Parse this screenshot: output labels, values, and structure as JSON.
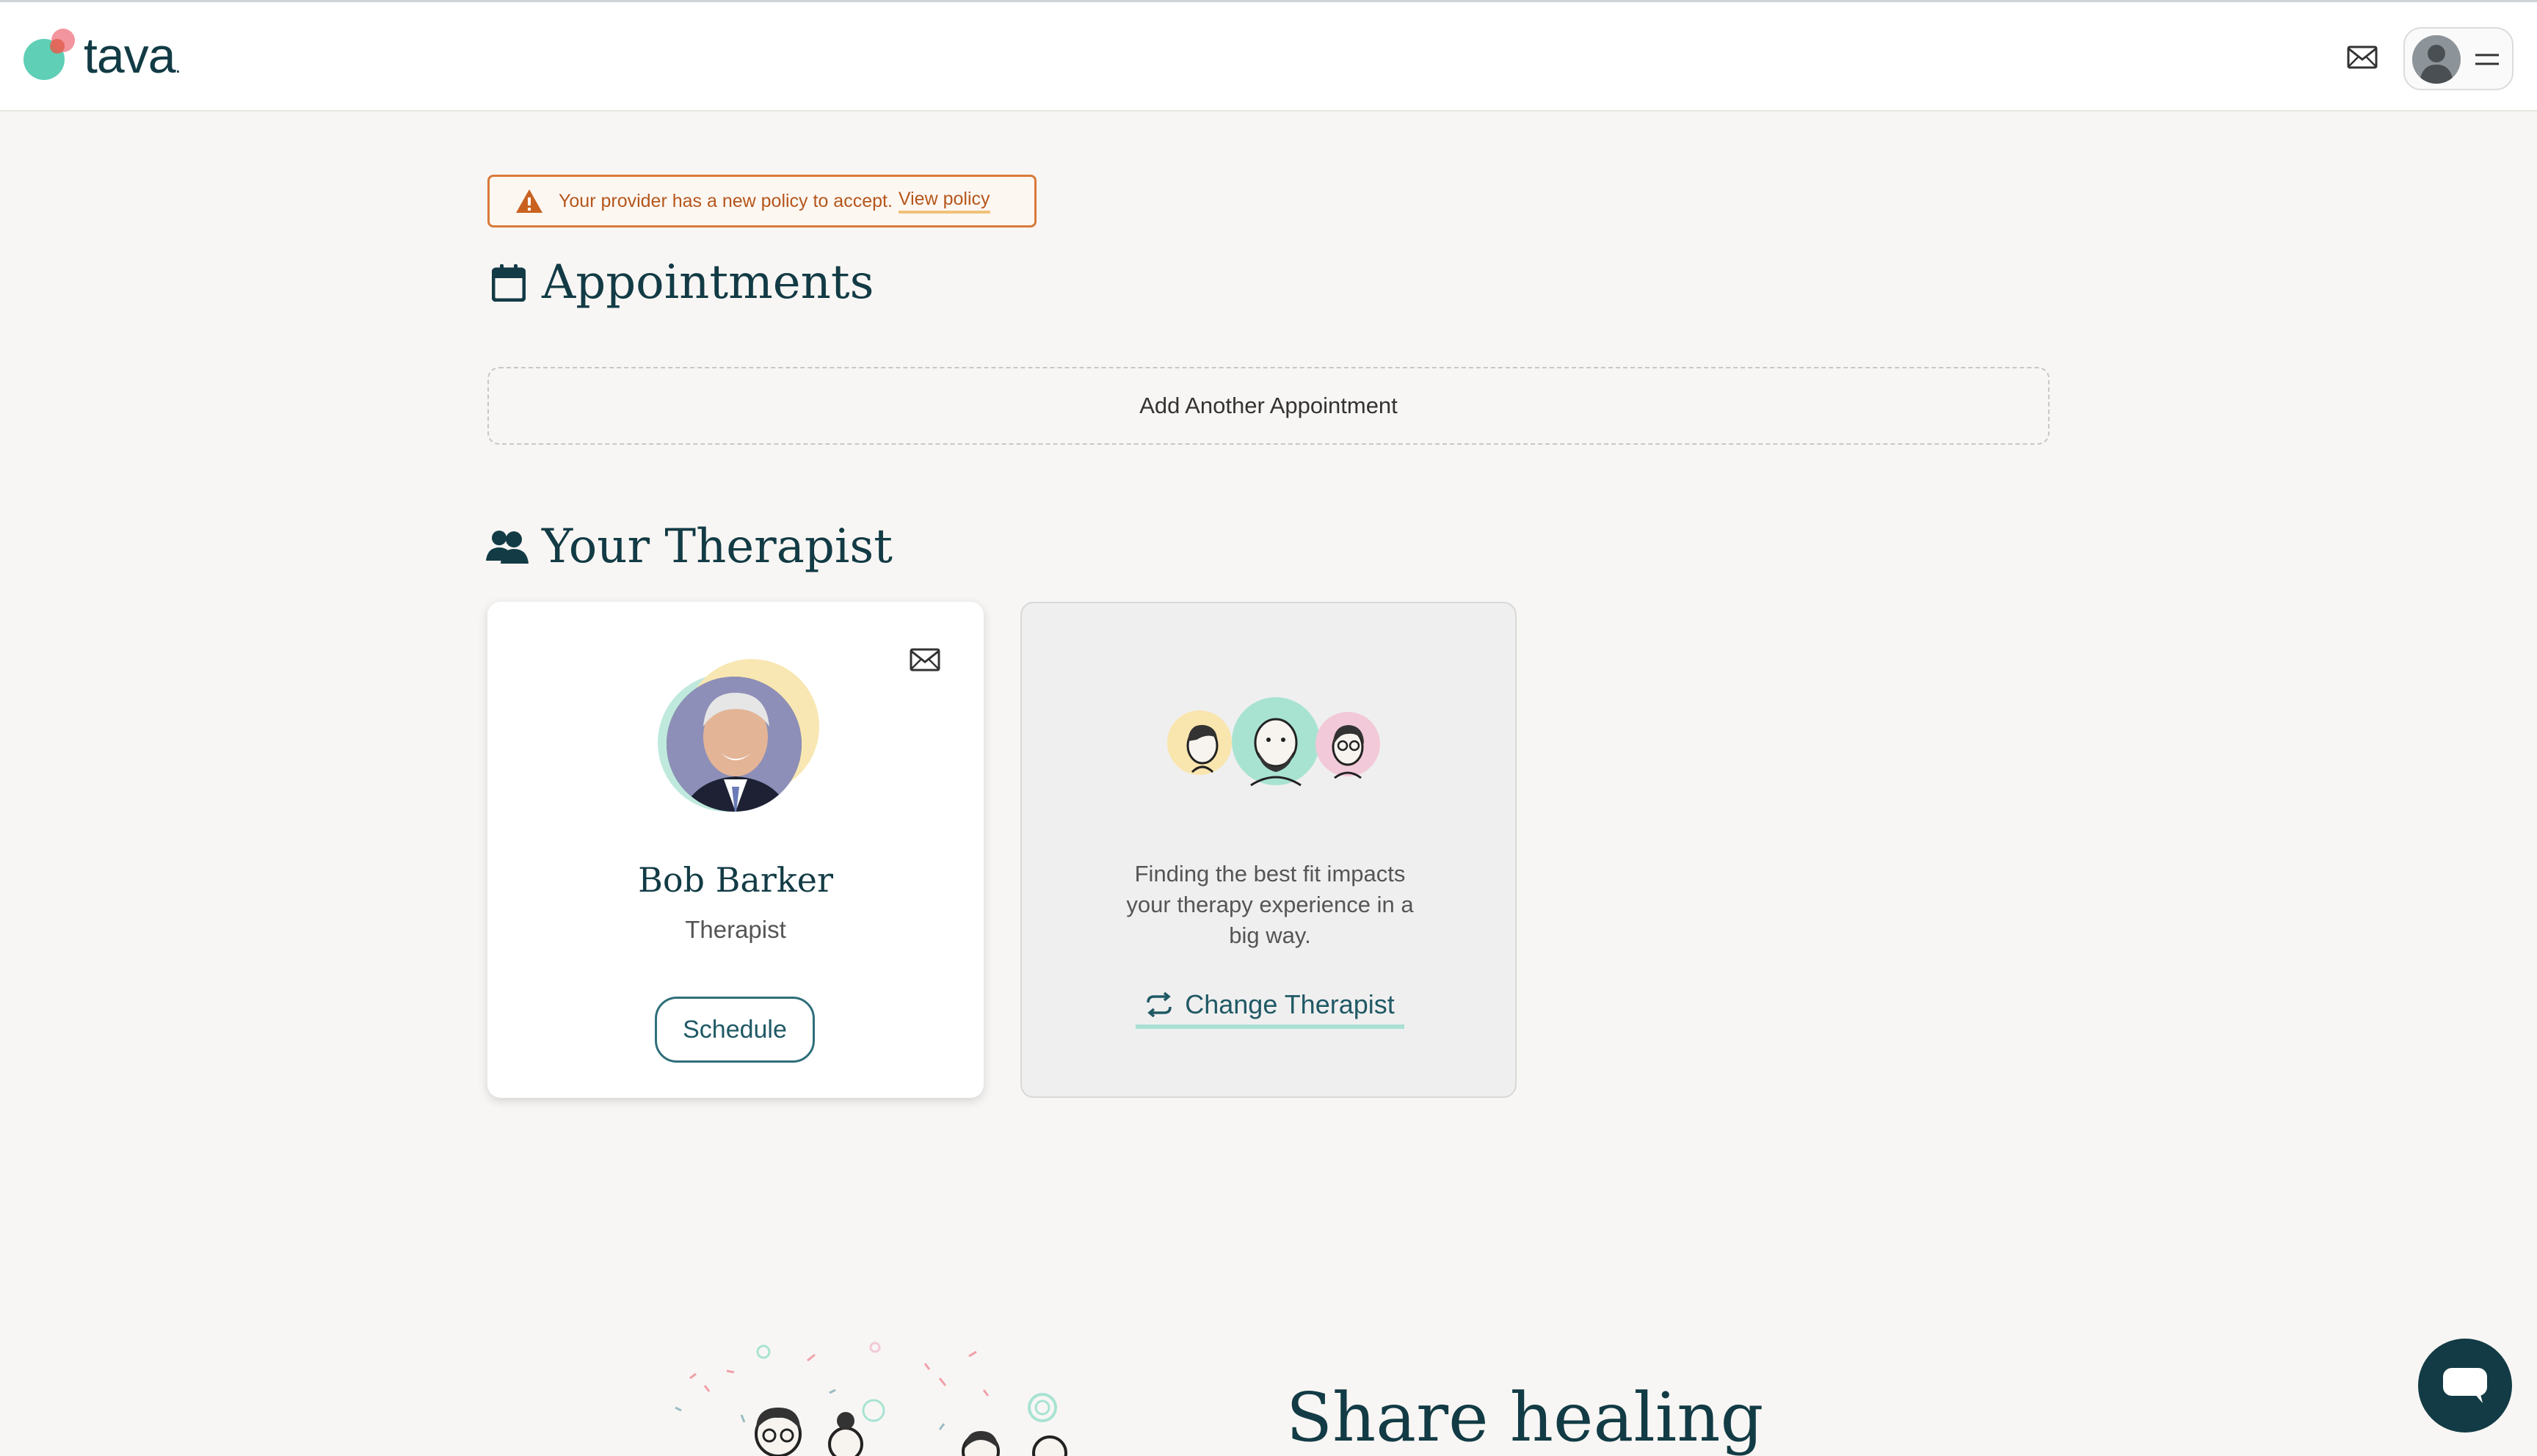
{
  "header": {
    "logo_text": "tava",
    "logo_suffix": ".",
    "mail_icon": "mail-icon",
    "menu_icon": "hamburger-icon"
  },
  "alert": {
    "message": "Your provider has a new policy to accept.",
    "link": "View policy",
    "icon": "warning-icon"
  },
  "appointments": {
    "title": "Appointments",
    "icon": "calendar-icon",
    "add_label": "Add Another Appointment"
  },
  "therapist": {
    "title": "Your Therapist",
    "icon": "users-icon",
    "name": "Bob Barker",
    "role": "Therapist",
    "schedule_label": "Schedule"
  },
  "change_card": {
    "description": "Finding the best fit impacts your therapy experience in a big way.",
    "button_label": "Change Therapist",
    "icon": "swap-icon"
  },
  "share": {
    "title": "Share healing"
  },
  "colors": {
    "primary": "#123b45",
    "accent_teal": "#a9e0d3",
    "alert_orange": "#d97a3a",
    "background": "#f8f6f4"
  }
}
